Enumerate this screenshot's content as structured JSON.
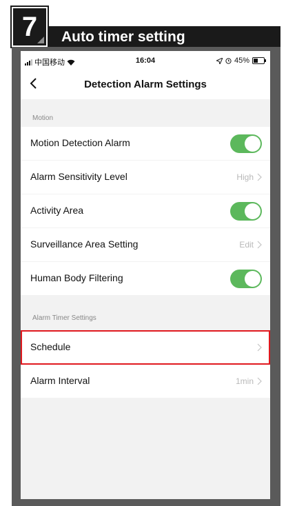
{
  "banner": {
    "step_number": "7",
    "title": "Auto timer setting"
  },
  "status_bar": {
    "carrier": "中国移动",
    "time": "16:04",
    "battery": "45%",
    "battery_level": 0.45
  },
  "nav": {
    "title": "Detection Alarm Settings",
    "back_icon": "chevron-left-icon"
  },
  "motion": {
    "section_label": "Motion",
    "items": [
      {
        "label": "Motion Detection Alarm",
        "toggle": true
      },
      {
        "label": "Alarm Sensitivity Level",
        "value": "High"
      },
      {
        "label": "Activity Area",
        "toggle": true
      },
      {
        "label": "Surveillance Area Setting",
        "value": "Edit"
      },
      {
        "label": "Human Body Filtering",
        "toggle": true
      }
    ]
  },
  "timer": {
    "section_label": "Alarm Timer Settings",
    "items": [
      {
        "label": "Schedule",
        "value": ""
      },
      {
        "label": "Alarm Interval",
        "value": "1min"
      }
    ]
  },
  "colors": {
    "toggle_on": "#5cb85c",
    "highlight": "#e0181e",
    "banner": "#1a1a1a"
  }
}
